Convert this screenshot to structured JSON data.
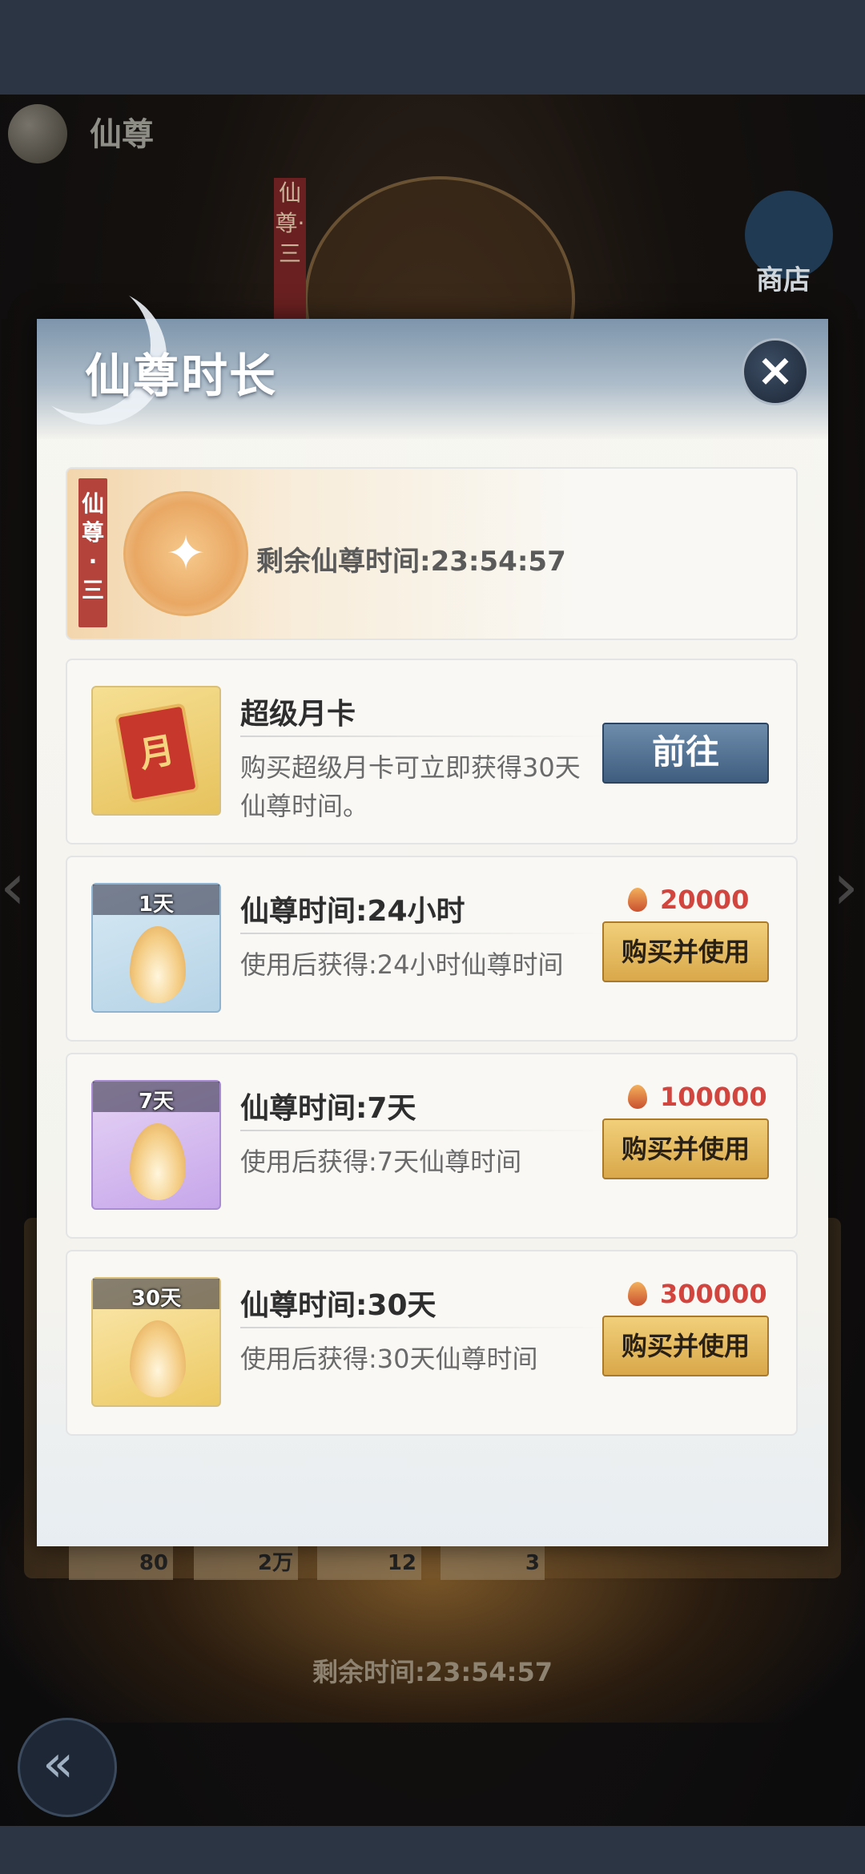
{
  "background": {
    "page_title": "仙尊",
    "rank_banner": "仙尊·三",
    "shop_label": "商店",
    "item_counts": [
      "80",
      "2万",
      "12",
      "3"
    ],
    "remaining_time": "剩余时间:23:54:57"
  },
  "dialog": {
    "title": "仙尊时长",
    "close_icon": "×",
    "status": {
      "rank_banner": "仙尊·三",
      "remaining_text": "剩余仙尊时间:23:54:57"
    },
    "monthly_card": {
      "title": "超级月卡",
      "description": "购买超级月卡可立即获得30天仙尊时间。",
      "icon_glyph": "月",
      "button": "前往"
    },
    "items": [
      {
        "tag": "1天",
        "title": "仙尊时间:24小时",
        "description": "使用后获得:24小时仙尊时间",
        "price": "20000",
        "button": "购买并使用",
        "color": "#b5d3e6"
      },
      {
        "tag": "7天",
        "title": "仙尊时间:7天",
        "description": "使用后获得:7天仙尊时间",
        "price": "100000",
        "button": "购买并使用",
        "color": "#c6a6ea"
      },
      {
        "tag": "30天",
        "title": "仙尊时间:30天",
        "description": "使用后获得:30天仙尊时间",
        "price": "300000",
        "button": "购买并使用",
        "color": "#ecc963"
      }
    ]
  },
  "colors": {
    "price": "#d2453f",
    "go_button": "#4f6d8f",
    "buy_button": "#e3bb5f",
    "rank_banner": "#b4433c"
  }
}
